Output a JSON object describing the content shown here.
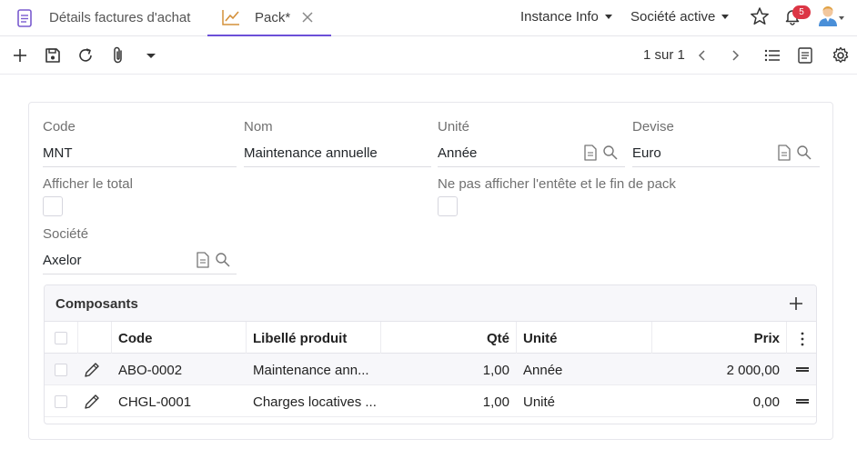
{
  "tabs": [
    {
      "label": "Détails factures d'achat",
      "icon": "document-icon",
      "active": false
    },
    {
      "label": "Pack*",
      "icon": "chart-line-icon",
      "active": true
    }
  ],
  "top_menus": {
    "instance": "Instance Info",
    "societe": "Société active"
  },
  "notifications": {
    "count": "5"
  },
  "pager": {
    "text": "1 sur 1"
  },
  "form": {
    "code": {
      "label": "Code",
      "value": "MNT"
    },
    "nom": {
      "label": "Nom",
      "value": "Maintenance annuelle"
    },
    "unite": {
      "label": "Unité",
      "value": "Année"
    },
    "devise": {
      "label": "Devise",
      "value": "Euro"
    },
    "afficher_total": {
      "label": "Afficher le total",
      "checked": false
    },
    "ne_pas_afficher": {
      "label": "Ne pas afficher l'entête et le fin de pack",
      "checked": false
    },
    "societe": {
      "label": "Société",
      "value": "Axelor"
    }
  },
  "composants": {
    "title": "Composants",
    "columns": [
      "Code",
      "Libellé produit",
      "Qté",
      "Unité",
      "Prix"
    ],
    "rows": [
      {
        "code": "ABO-0002",
        "libelle": "Maintenance ann...",
        "qte": "1,00",
        "unite": "Année",
        "prix": "2 000,00"
      },
      {
        "code": "CHGL-0001",
        "libelle": "Charges locatives ...",
        "qte": "1,00",
        "unite": "Unité",
        "prix": "0,00"
      }
    ]
  },
  "colors": {
    "accent": "#6b4fd8",
    "badge": "#dc3545",
    "chart_icon": "#d4903a"
  }
}
